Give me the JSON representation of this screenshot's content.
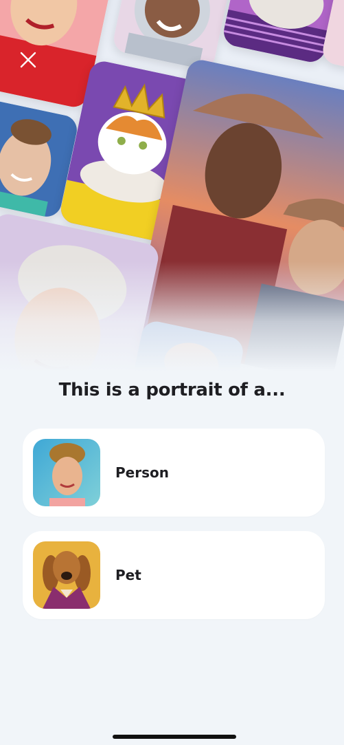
{
  "header": {
    "close_icon": "close-icon"
  },
  "prompt": {
    "title": "This is a portrait of a..."
  },
  "options": [
    {
      "label": "Person",
      "thumbnail": "person-portrait-thumbnail"
    },
    {
      "label": "Pet",
      "thumbnail": "pet-portrait-thumbnail"
    }
  ],
  "colors": {
    "background": "#f1f5f9",
    "card": "#ffffff",
    "text": "#1e1e22"
  }
}
